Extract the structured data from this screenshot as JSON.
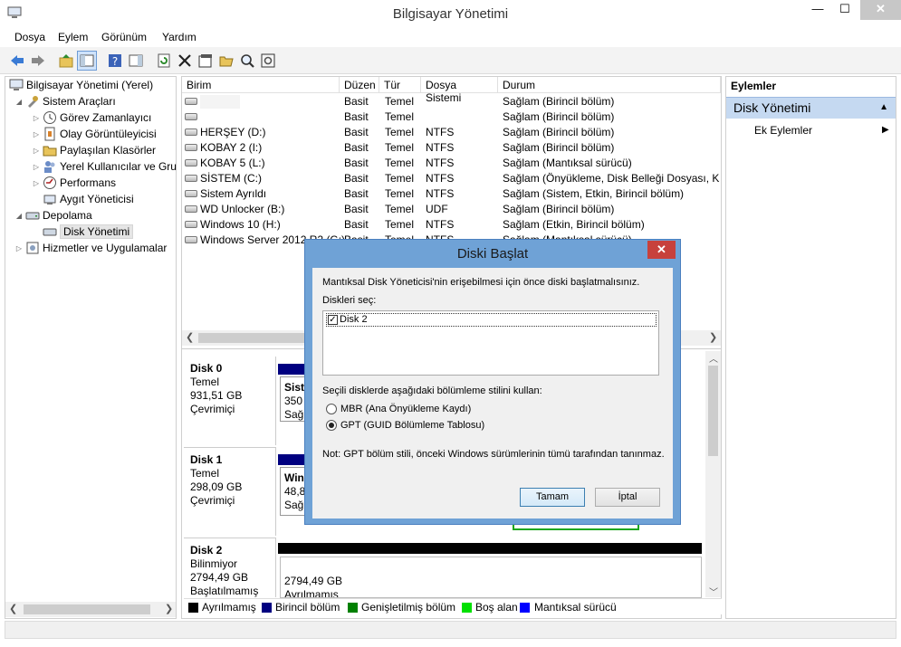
{
  "window": {
    "title": "Bilgisayar Yönetimi",
    "minimize": "—",
    "maximize": "☐",
    "close": "✕"
  },
  "menu": [
    "Dosya",
    "Eylem",
    "Görünüm",
    "Yardım"
  ],
  "tree": [
    {
      "label": "Bilgisayar Yönetimi (Yerel)",
      "level": 0,
      "expander": "",
      "icon": "computer-icon"
    },
    {
      "label": "Sistem Araçları",
      "level": 1,
      "expander": "◢",
      "icon": "tools-icon"
    },
    {
      "label": "Görev Zamanlayıcı",
      "level": 2,
      "expander": "▷",
      "icon": "clock-icon"
    },
    {
      "label": "Olay Görüntüleyicisi",
      "level": 2,
      "expander": "▷",
      "icon": "event-viewer-icon"
    },
    {
      "label": "Paylaşılan Klasörler",
      "level": 2,
      "expander": "▷",
      "icon": "shared-folder-icon"
    },
    {
      "label": "Yerel Kullanıcılar ve Gru",
      "level": 2,
      "expander": "▷",
      "icon": "users-icon"
    },
    {
      "label": "Performans",
      "level": 2,
      "expander": "▷",
      "icon": "performance-icon"
    },
    {
      "label": "Aygıt Yöneticisi",
      "level": 2,
      "expander": "",
      "icon": "device-manager-icon"
    },
    {
      "label": "Depolama",
      "level": 1,
      "expander": "◢",
      "icon": "storage-icon"
    },
    {
      "label": "Disk Yönetimi",
      "level": 2,
      "expander": "",
      "icon": "disk-management-icon",
      "selected": true
    },
    {
      "label": "Hizmetler ve Uygulamalar",
      "level": 1,
      "expander": "▷",
      "icon": "services-icon"
    }
  ],
  "volumes": {
    "headers": [
      "Birim",
      "Düzen",
      "Tür",
      "Dosya Sistemi",
      "Durum"
    ],
    "rows": [
      [
        "",
        "Basit",
        "Temel",
        "",
        "Sağlam (Birincil bölüm)"
      ],
      [
        "",
        "Basit",
        "Temel",
        "",
        "Sağlam (Birincil bölüm)"
      ],
      [
        "HERŞEY (D:)",
        "Basit",
        "Temel",
        "NTFS",
        "Sağlam (Birincil bölüm)"
      ],
      [
        "KOBAY 2 (I:)",
        "Basit",
        "Temel",
        "NTFS",
        "Sağlam (Birincil bölüm)"
      ],
      [
        "KOBAY 5 (L:)",
        "Basit",
        "Temel",
        "NTFS",
        "Sağlam (Mantıksal sürücü)"
      ],
      [
        "SİSTEM (C:)",
        "Basit",
        "Temel",
        "NTFS",
        "Sağlam (Önyükleme, Disk Belleği Dosyası, Kilitlenme"
      ],
      [
        "Sistem Ayrıldı",
        "Basit",
        "Temel",
        "NTFS",
        "Sağlam (Sistem, Etkin, Birincil bölüm)"
      ],
      [
        "WD Unlocker (B:)",
        "Basit",
        "Temel",
        "UDF",
        "Sağlam (Birincil bölüm)"
      ],
      [
        "Windows 10 (H:)",
        "Basit",
        "Temel",
        "NTFS",
        "Sağlam (Etkin, Birincil bölüm)"
      ],
      [
        "Windows Server 2012 R2 (G:)",
        "Basit",
        "Temel",
        "NTFS",
        "Sağlam (Mantıksal sürücü)"
      ]
    ]
  },
  "disks": [
    {
      "name": "Disk 0",
      "type": "Temel",
      "size": "931,51 GB",
      "status": "Çevrimiçi",
      "part_name": "Siste",
      "part_size": "350 N",
      "part_status": "Sağla"
    },
    {
      "name": "Disk 1",
      "type": "Temel",
      "size": "298,09 GB",
      "status": "Çevrimiçi",
      "part_name": "Wind",
      "part_size": "48,83",
      "part_status": "Sağla"
    },
    {
      "name": "Disk 2",
      "type": "Bilinmiyor",
      "size": "2794,49 GB",
      "status": "Başlatılmamış",
      "part_size": "2794,49 GB",
      "part_status": "Ayrılmamış"
    }
  ],
  "legend": [
    {
      "label": "Ayrılmamış",
      "color": "#000000"
    },
    {
      "label": "Birincil bölüm",
      "color": "#000080"
    },
    {
      "label": "Genişletilmiş bölüm",
      "color": "#008000"
    },
    {
      "label": "Boş alan",
      "color": "#00e000"
    },
    {
      "label": "Mantıksal sürücü",
      "color": "#0000ff"
    }
  ],
  "actions": {
    "header": "Eylemler",
    "section": "Disk Yönetimi",
    "item": "Ek Eylemler"
  },
  "dialog": {
    "title": "Diski Başlat",
    "intro": "Mantıksal Disk Yöneticisi'nin erişebilmesi için önce diski başlatmalısınız.",
    "select_label": "Diskleri seç:",
    "disk_item": "Disk 2",
    "style_label": "Seçili disklerde aşağıdaki bölümleme stilini kullan:",
    "mbr": "MBR (Ana Önyükleme Kaydı)",
    "gpt": "GPT (GUID Bölümleme Tablosu)",
    "note": "Not: GPT bölüm stili, önceki Windows sürümlerinin tümü tarafından tanınmaz.",
    "ok": "Tamam",
    "cancel": "İptal"
  }
}
